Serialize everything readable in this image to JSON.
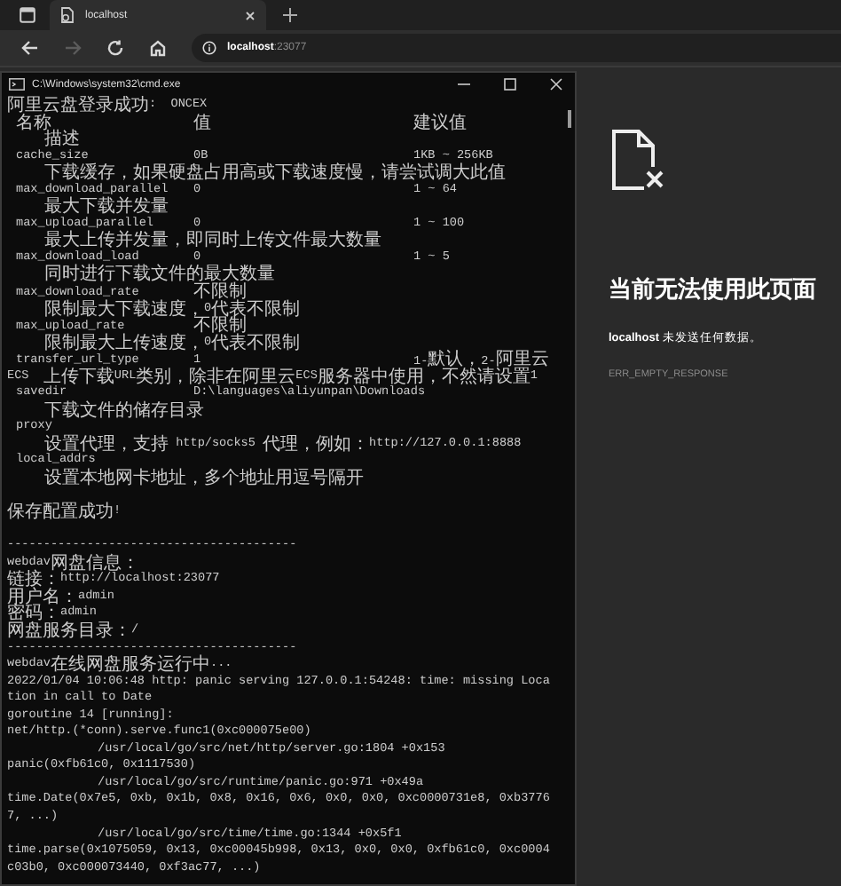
{
  "browser": {
    "tabs": [
      {
        "label": "localhost",
        "selected": true
      }
    ],
    "nav_buttons": [
      {
        "kind": "back",
        "disabled": false
      },
      {
        "kind": "forward",
        "disabled": true
      },
      {
        "kind": "reload",
        "disabled": false
      },
      {
        "kind": "home",
        "disabled": false
      }
    ],
    "address": {
      "host": "localhost",
      "port": ":23077"
    }
  },
  "terminal": {
    "title": "C:\\Windows\\system32\\cmd.exe",
    "lines": [
      {
        "kind": "text",
        "text": "阿里云盘登录成功:  ONCEX"
      },
      {
        "kind": "setting",
        "name": "名称",
        "value": "值",
        "range": "建议值"
      },
      {
        "kind": "desc",
        "text": "描述"
      },
      {
        "kind": "setting",
        "name": "cache_size",
        "value": "0B",
        "range": "1KB ~ 256KB"
      },
      {
        "kind": "desc",
        "text": "下载缓存，如果硬盘占用高或下载速度慢，请尝试调大此值"
      },
      {
        "kind": "setting",
        "name": "max_download_parallel",
        "value": "0",
        "range": "1 ~ 64"
      },
      {
        "kind": "desc",
        "text": "最大下载并发量"
      },
      {
        "kind": "setting",
        "name": "max_upload_parallel",
        "value": "0",
        "range": "1 ~ 100"
      },
      {
        "kind": "desc",
        "text": "最大上传并发量，即同时上传文件最大数量"
      },
      {
        "kind": "setting",
        "name": "max_download_load",
        "value": "0",
        "range": "1 ~ 5"
      },
      {
        "kind": "desc",
        "text": "同时进行下载文件的最大数量"
      },
      {
        "kind": "setting",
        "name": "max_download_rate",
        "value": "不限制"
      },
      {
        "kind": "desc",
        "text": "限制最大下载速度，0代表不限制"
      },
      {
        "kind": "setting",
        "name": "max_upload_rate",
        "value": "不限制"
      },
      {
        "kind": "desc",
        "text": "限制最大上传速度，0代表不限制"
      },
      {
        "kind": "setting",
        "name": "transfer_url_type",
        "value": "1",
        "range": "1-默认，2-阿里云"
      },
      {
        "kind": "text",
        "text": "ECS  上传下载URL类别，除非在阿里云ECS服务器中使用，不然请设置1"
      },
      {
        "kind": "setting",
        "name": "savedir",
        "value": "D:\\languages\\aliyunpan\\Downloads"
      },
      {
        "kind": "desc",
        "text": "下载文件的储存目录"
      },
      {
        "kind": "setting",
        "name": "proxy"
      },
      {
        "kind": "desc",
        "text": "设置代理，支持 http/socks5 代理，例如：http://127.0.0.1:8888"
      },
      {
        "kind": "setting",
        "name": "local_addrs"
      },
      {
        "kind": "desc",
        "text": "设置本地网卡地址，多个地址用逗号隔开"
      },
      {
        "kind": "gap"
      },
      {
        "kind": "text",
        "text": "保存配置成功!"
      },
      {
        "kind": "gap"
      },
      {
        "kind": "text",
        "text": "----------------------------------------"
      },
      {
        "kind": "text",
        "text": "webdav网盘信息："
      },
      {
        "kind": "text",
        "text": "链接：http://localhost:23077"
      },
      {
        "kind": "text",
        "text": "用户名：admin"
      },
      {
        "kind": "text",
        "text": "密码：admin"
      },
      {
        "kind": "text",
        "text": "网盘服务目录：/"
      },
      {
        "kind": "text",
        "text": "----------------------------------------"
      },
      {
        "kind": "text",
        "text": "webdav在线网盘服务运行中..."
      },
      {
        "kind": "text",
        "text": "2022/01/04 10:06:48 http: panic serving 127.0.0.1:54248: time: missing Loca"
      },
      {
        "kind": "text",
        "text": "tion in call to Date"
      },
      {
        "kind": "text",
        "text": "goroutine 14 [running]:"
      },
      {
        "kind": "text",
        "text": "net/http.(*conn).serve.func1(0xc000075e00)"
      },
      {
        "kind": "trace",
        "text": "/usr/local/go/src/net/http/server.go:1804 +0x153"
      },
      {
        "kind": "text",
        "text": "panic(0xfb61c0, 0x1117530)"
      },
      {
        "kind": "trace",
        "text": "/usr/local/go/src/runtime/panic.go:971 +0x49a"
      },
      {
        "kind": "text",
        "text": "time.Date(0x7e5, 0xb, 0x1b, 0x8, 0x16, 0x6, 0x0, 0x0, 0xc0000731e8, 0xb3776"
      },
      {
        "kind": "text",
        "text": "7, ...)"
      },
      {
        "kind": "trace",
        "text": "/usr/local/go/src/time/time.go:1344 +0x5f1"
      },
      {
        "kind": "text",
        "text": "time.parse(0x1075059, 0x13, 0xc00045b998, 0x13, 0x0, 0x0, 0xfb61c0, 0xc0004"
      },
      {
        "kind": "text",
        "text": "c03b0, 0xc000073440, 0xf3ac77, ...)"
      }
    ]
  },
  "error_page": {
    "heading": "当前无法使用此页面",
    "message": "**localhost** 未发送任何数据。",
    "code": "ERR_EMPTY_RESPONSE"
  }
}
